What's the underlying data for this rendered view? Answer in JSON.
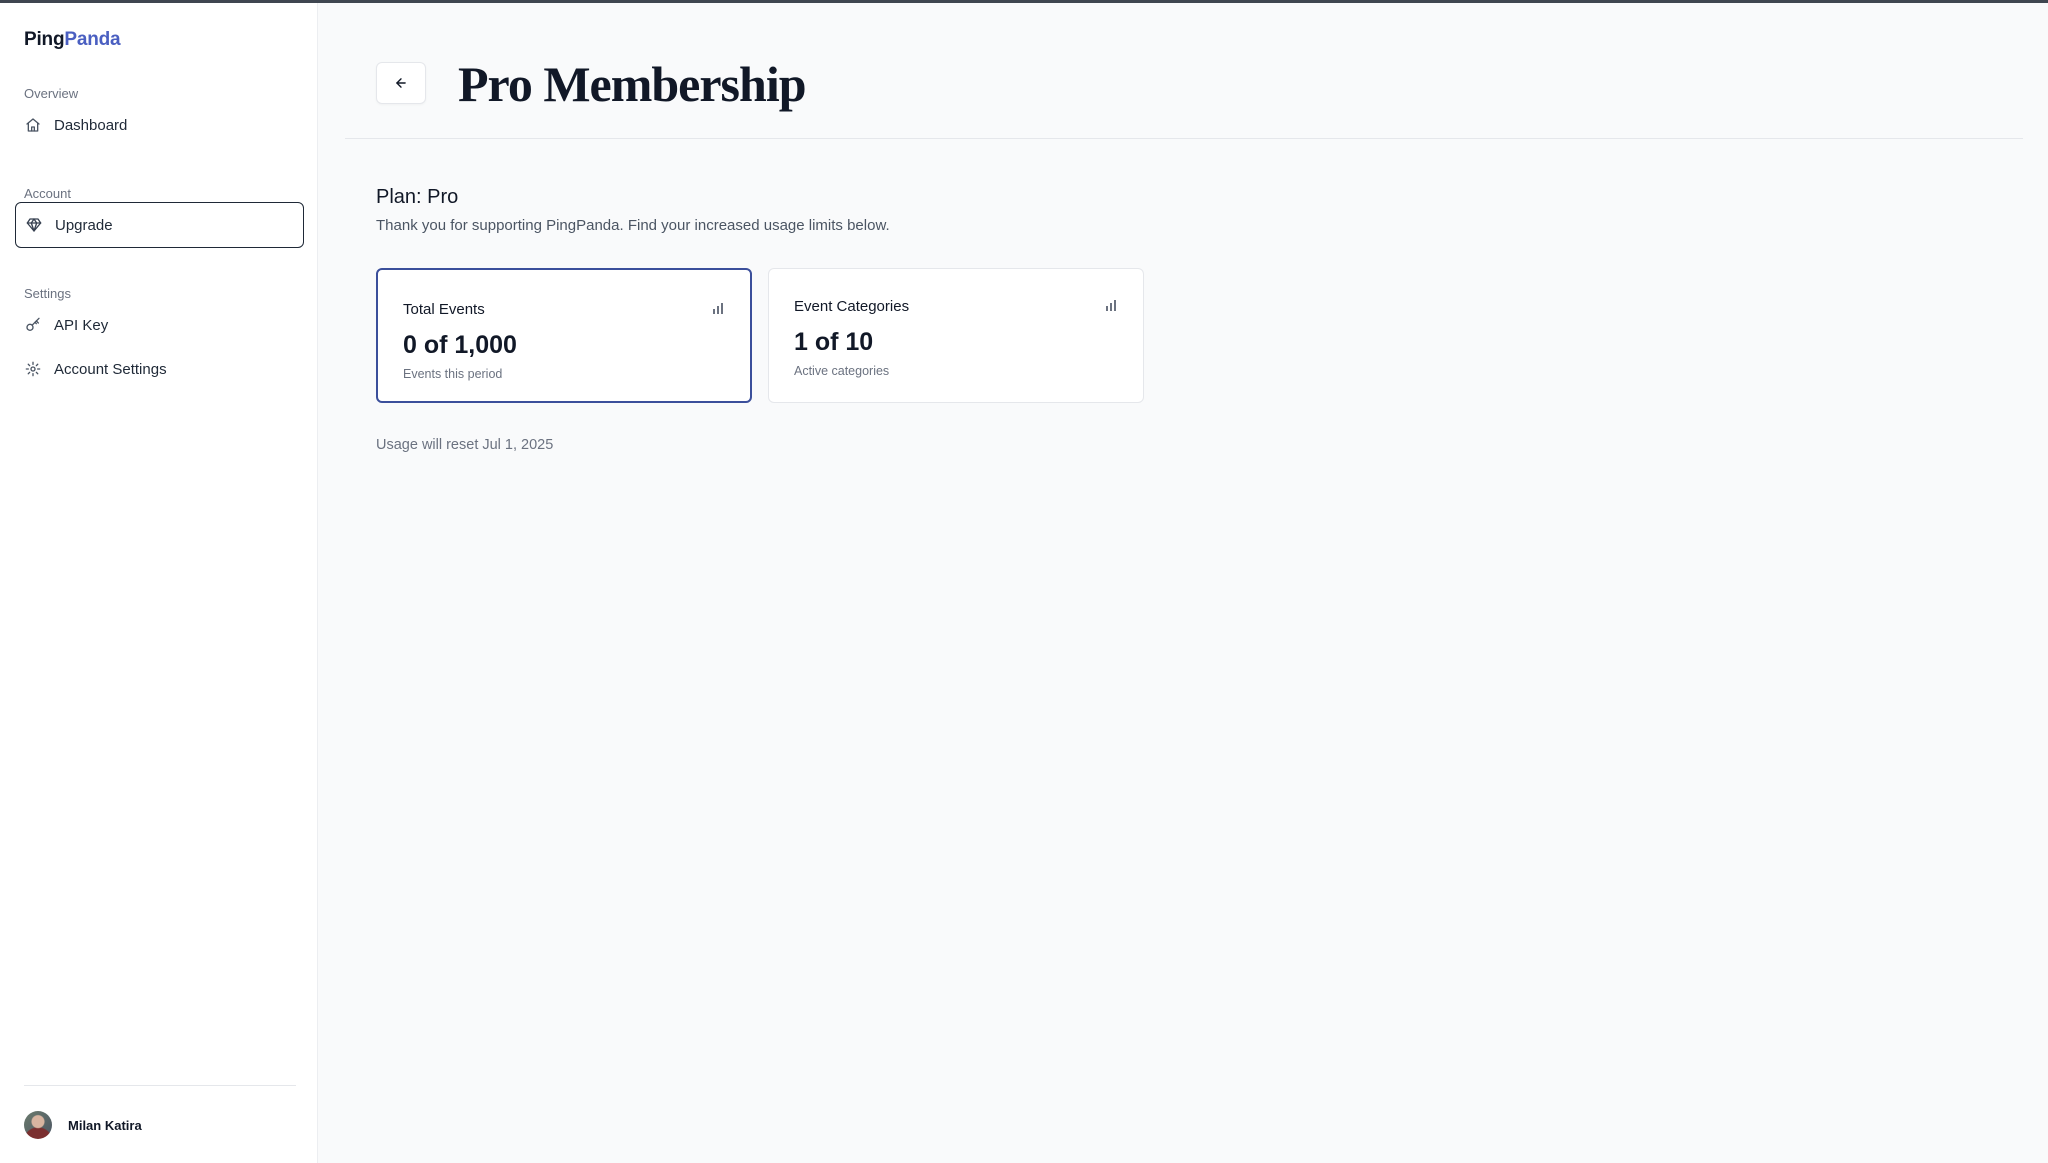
{
  "brand": {
    "part1": "Ping",
    "part2": "Panda"
  },
  "sidebar": {
    "sections": [
      {
        "label": "Overview",
        "items": [
          {
            "label": "Dashboard",
            "icon": "home-icon"
          }
        ]
      },
      {
        "label": "Account",
        "items": [
          {
            "label": "Upgrade",
            "icon": "gem-icon",
            "active": true
          }
        ]
      },
      {
        "label": "Settings",
        "items": [
          {
            "label": "API Key",
            "icon": "key-icon"
          },
          {
            "label": "Account Settings",
            "icon": "gear-icon"
          }
        ]
      }
    ],
    "user": {
      "name": "Milan Katira"
    }
  },
  "header": {
    "title": "Pro Membership",
    "back_icon": "arrow-left-icon"
  },
  "plan": {
    "title": "Plan: Pro",
    "description": "Thank you for supporting PingPanda. Find your increased usage limits below."
  },
  "cards": [
    {
      "title": "Total Events",
      "value": "0 of 1,000",
      "subtitle": "Events this period",
      "icon": "bar-chart-icon"
    },
    {
      "title": "Event Categories",
      "value": "1 of 10",
      "subtitle": "Active categories",
      "icon": "bar-chart-icon"
    }
  ],
  "reset_text": "Usage will reset Jul 1, 2025",
  "colors": {
    "brand_accent": "#4a5fc1",
    "selected_card_border": "#3b4f9b"
  }
}
